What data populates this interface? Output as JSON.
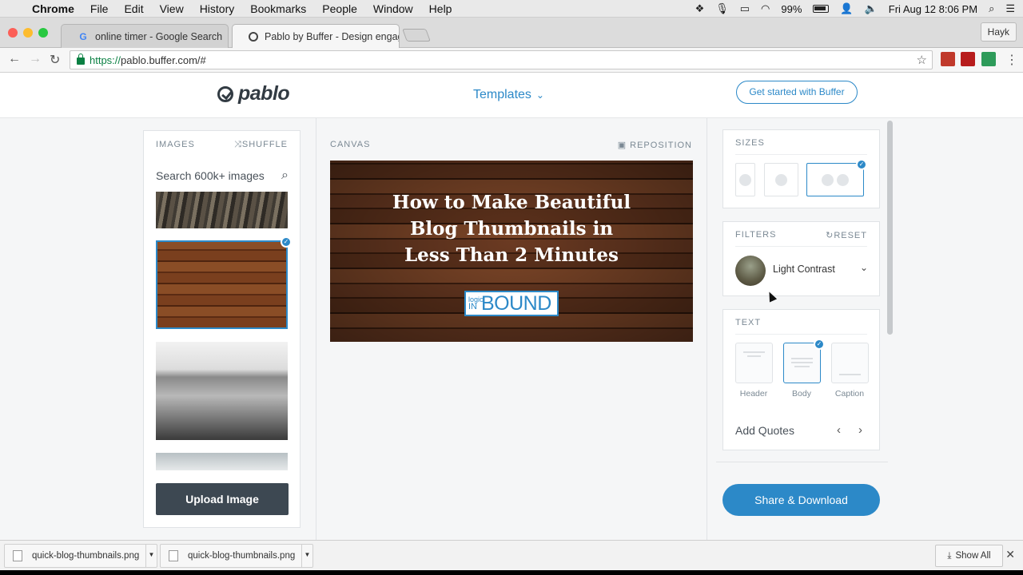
{
  "mac_menu": {
    "app": "Chrome",
    "items": [
      "File",
      "Edit",
      "View",
      "History",
      "Bookmarks",
      "People",
      "Window",
      "Help"
    ],
    "battery": "99%",
    "datetime": "Fri Aug 12  8:06 PM"
  },
  "browser": {
    "tabs": [
      {
        "title": "online timer - Google Search",
        "favicon": "G"
      },
      {
        "title": "Pablo by Buffer - Design engag",
        "favicon": "pablo-icon"
      }
    ],
    "profile": "Hayk",
    "url_secure": "https://",
    "url_rest": "pablo.buffer.com/#"
  },
  "header": {
    "logo_text": "pablo",
    "templates_label": "Templates",
    "cta_label": "Get started with Buffer"
  },
  "images_panel": {
    "title": "IMAGES",
    "shuffle_label": "SHUFFLE",
    "search_placeholder": "Search 600k+ images",
    "upload_label": "Upload Image"
  },
  "canvas": {
    "label": "CANVAS",
    "reposition_label": "REPOSITION",
    "title_lines": [
      "How to Make Beautiful",
      "Blog Thumbnails in",
      "Less Than 2 Minutes"
    ],
    "logo_small": "logic",
    "logo_small2": "IN",
    "logo_big": "BOUND"
  },
  "sizes": {
    "title": "SIZES"
  },
  "filters": {
    "title": "FILTERS",
    "reset_label": "RESET",
    "selected": "Light Contrast"
  },
  "text_panel": {
    "title": "TEXT",
    "options": [
      "Header",
      "Body",
      "Caption"
    ],
    "add_quotes": "Add Quotes"
  },
  "share_label": "Share & Download",
  "downloads": {
    "files": [
      "quick-blog-thumbnails.png",
      "quick-blog-thumbnails.png"
    ],
    "show_all": "Show All"
  },
  "colors": {
    "accent": "#2c89c8",
    "dark_button": "#3d4852"
  }
}
